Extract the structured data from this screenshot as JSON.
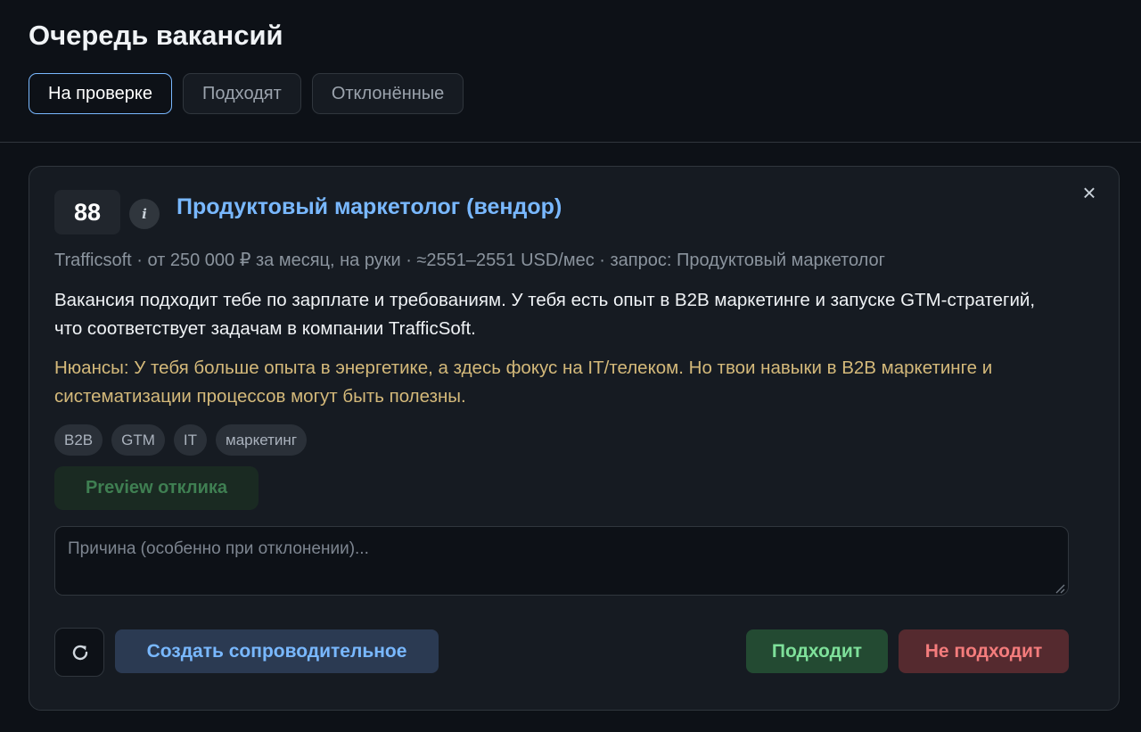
{
  "page": {
    "title": "Очередь вакансий"
  },
  "tabs": [
    {
      "label": "На проверке",
      "active": true
    },
    {
      "label": "Подходят",
      "active": false
    },
    {
      "label": "Отклонённые",
      "active": false
    }
  ],
  "card": {
    "score": "88",
    "info_icon": "i",
    "title": "Продуктовый маркетолог (вендор)",
    "close_icon": "×",
    "meta": "Trafficsoft · от 250 000 ₽ за месяц, на руки · ≈2551–2551 USD/мес · запрос: Продуктовый маркетолог",
    "summary": "Вакансия подходит тебе по зарплате и требованиям. У тебя есть опыт в B2B маркетинге и запуске GTM-стратегий, что соответствует задачам в компании TrafficSoft.",
    "nuances": "Нюансы: У тебя больше опыта в энергетике, а здесь фокус на IT/телеком. Но твои навыки в B2B маркетинге и систематизации процессов могут быть полезны.",
    "tags": [
      "B2B",
      "GTM",
      "IT",
      "маркетинг"
    ],
    "preview_label": "Preview отклика",
    "reason_placeholder": "Причина (особенно при отклонении)...",
    "cover_label": "Создать сопроводительное",
    "approve_label": "Подходит",
    "reject_label": "Не подходит"
  },
  "icons": {
    "info": "info-icon",
    "close": "close-icon",
    "refresh": "refresh-icon"
  },
  "colors": {
    "background": "#0d1117",
    "card": "#161b22",
    "accent_blue": "#79b8ff",
    "nuance": "#d4b97a",
    "approve": "#7ee09a",
    "reject": "#f47c7c"
  }
}
